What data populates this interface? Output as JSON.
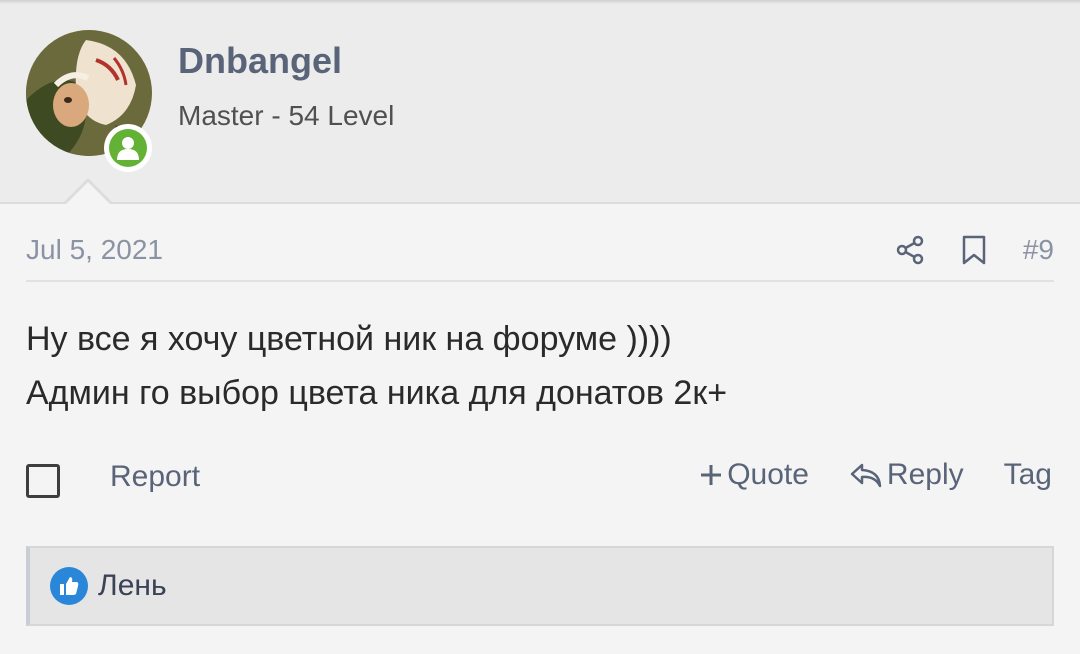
{
  "user": {
    "name": "Dnbangel",
    "title": "Master - 54 Level"
  },
  "post": {
    "date": "Jul 5, 2021",
    "number": "#9",
    "lines": [
      "Ну все я хочу цветной ник на форуме ))))",
      "Админ го выбор цвета ника для донатов 2к+"
    ]
  },
  "actions": {
    "report": "Report",
    "quote": "Quote",
    "reply": "Reply",
    "tag": "Tag"
  },
  "reactions": {
    "users": "Лень"
  },
  "icons": {
    "share": "share-icon",
    "bookmark": "bookmark-icon",
    "plus": "plus-icon",
    "reply": "reply-arrow-icon",
    "like": "thumbs-up-icon",
    "online": "online-user-icon"
  },
  "colors": {
    "username": "#5a6479",
    "online": "#63b135",
    "like": "#2a86d8"
  }
}
